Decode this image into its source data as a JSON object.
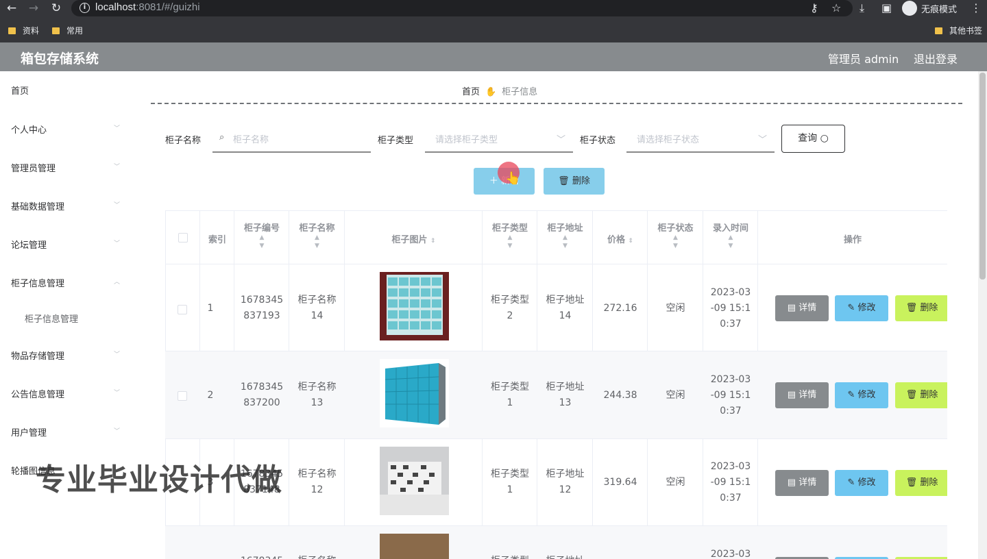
{
  "browser": {
    "url_host": "localhost",
    "url_path": ":8081/#/guizhi",
    "incognito_label": "无痕模式",
    "bookmarks": [
      "资料",
      "常用"
    ],
    "other_bookmarks": "其他书签"
  },
  "header": {
    "title": "箱包存储系统",
    "admin": "管理员 admin",
    "logout": "退出登录"
  },
  "sidebar": {
    "items": [
      "首页",
      "个人中心",
      "管理员管理",
      "基础数据管理",
      "论坛管理",
      "柜子信息管理",
      "柜子信息管理",
      "物品存储管理",
      "公告信息管理",
      "用户管理",
      "轮播图信息"
    ]
  },
  "breadcrumb": {
    "home": "首页",
    "current": "柜子信息"
  },
  "filters": {
    "name_label": "柜子名称",
    "name_placeholder": "柜子名称",
    "type_label": "柜子类型",
    "type_placeholder": "请选择柜子类型",
    "status_label": "柜子状态",
    "status_placeholder": "请选择柜子状态",
    "query": "查询"
  },
  "actions": {
    "add": "新增",
    "delete": "删除"
  },
  "table": {
    "headers": [
      "索引",
      "柜子编号",
      "柜子名称",
      "柜子图片",
      "柜子类型",
      "柜子地址",
      "价格",
      "柜子状态",
      "录入时间",
      "操作"
    ],
    "rows": [
      {
        "index": "1",
        "code": "1678345\n837193",
        "name": "柜子名称\n14",
        "type": "柜子类型\n2",
        "addr": "柜子地址\n14",
        "price": "272.16",
        "status": "空闲",
        "time": "2023-03\n-09 15:1\n0:37"
      },
      {
        "index": "2",
        "code": "1678345\n837200",
        "name": "柜子名称\n13",
        "type": "柜子类型\n1",
        "addr": "柜子地址\n13",
        "price": "244.38",
        "status": "空闲",
        "time": "2023-03\n-09 15:1\n0:37"
      },
      {
        "index": "3",
        "code": "1678345\n837148",
        "name": "柜子名称\n12",
        "type": "柜子类型\n1",
        "addr": "柜子地址\n12",
        "price": "319.64",
        "status": "空闲",
        "time": "2023-03\n-09 15:1\n0:37"
      },
      {
        "index": "",
        "code": "1678345",
        "name": "柜子名称",
        "type": "柜子类型",
        "addr": "柜子地址",
        "price": "",
        "status": "",
        "time": "2023-03"
      }
    ],
    "btn_detail": "详情",
    "btn_edit": "修改",
    "btn_delete": "删除"
  },
  "watermark": "专业毕业设计代做",
  "colors": {
    "header_bg": "#878b8e",
    "add_btn": "#87ceeb",
    "edit_btn": "#6ec6f0",
    "delete_btn": "#c9f25d"
  }
}
